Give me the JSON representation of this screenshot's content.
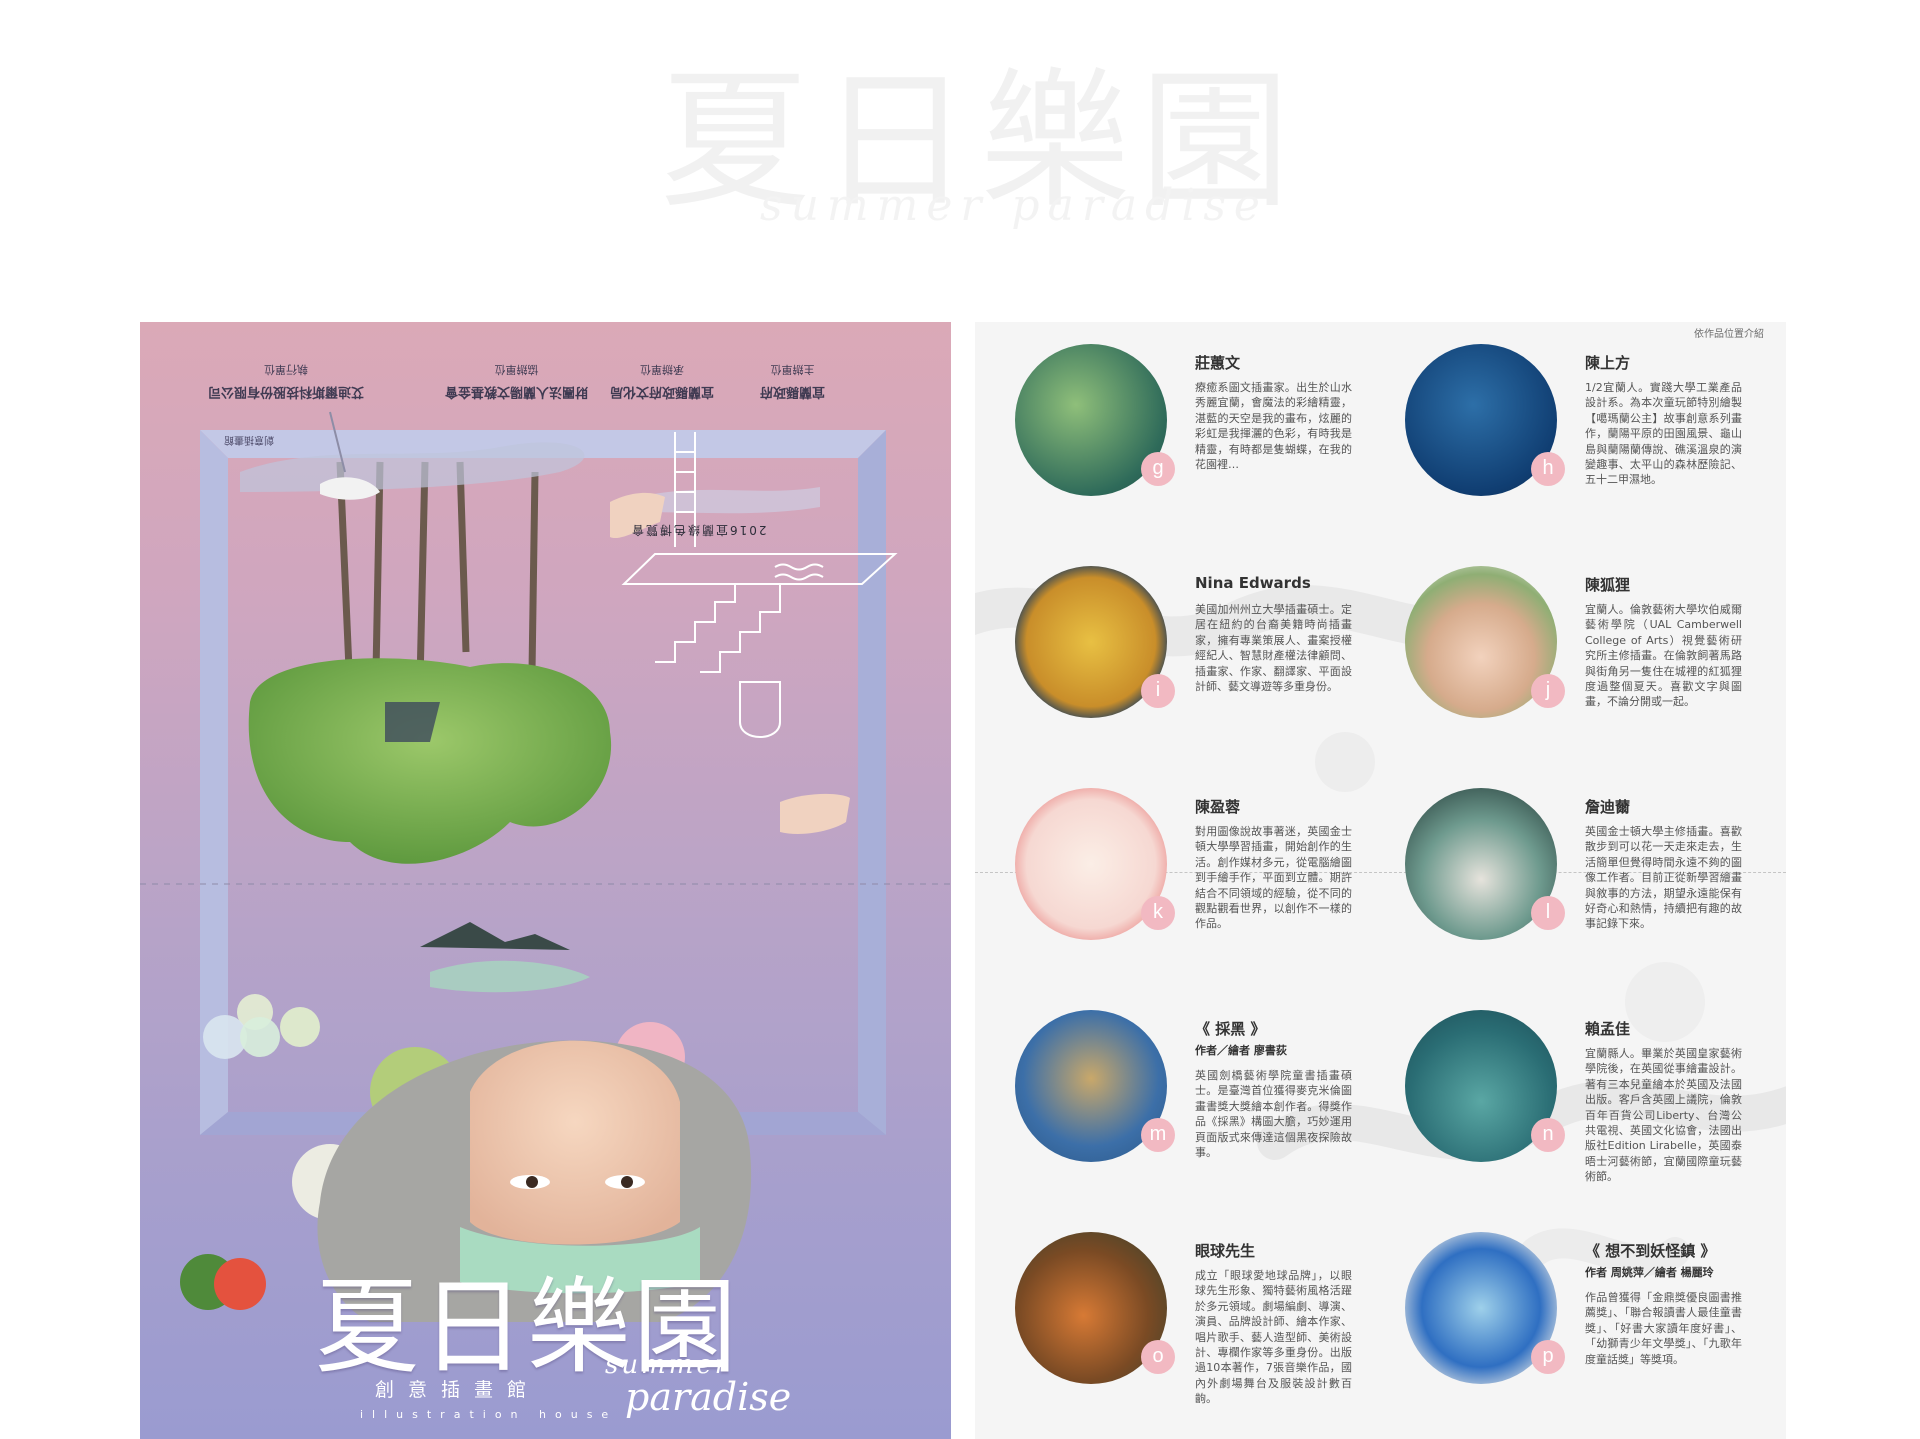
{
  "watermark": {
    "title": "夏日樂園",
    "subtitle": "summer paradise"
  },
  "poster": {
    "credits": [
      {
        "role": "主辦單位",
        "org": "宜蘭縣政府"
      },
      {
        "role": "承辦單位",
        "org": "宜蘭縣政府文化局"
      },
      {
        "role": "協辦單位",
        "org": "財團法人蘭陽文教基金會"
      },
      {
        "role": "執行單位",
        "org": "艾迪爾斯科技股份有限公司"
      }
    ],
    "year_title": "2016宜蘭綠色博覽會",
    "corner_text": "創意插畫館",
    "logo_cjk": "夏日樂園",
    "logo_subtitle": "創意插畫館",
    "logo_house": "illustration house",
    "logo_summer": "summer",
    "logo_paradise": "paradise"
  },
  "sheet": {
    "header": "依作品位置介紹",
    "artists": [
      {
        "letter": "g",
        "name": "莊蕙文",
        "bio": "療癒系圖文插畫家。出生於山水秀麗宜蘭，會魔法的彩繪精靈，湛藍的天空是我的畫布，炫麗的彩虹是我揮灑的色彩，有時我是精靈，有時都是隻蝴蝶，在我的花園裡…"
      },
      {
        "letter": "h",
        "name": "陳上方",
        "bio": "1/2宜蘭人。實踐大學工業產品設計系。為本次童玩節特別繪製【噶瑪蘭公主】故事創意系列畫作，蘭陽平原的田園風景、龜山島與蘭陽蘭傳說、礁溪溫泉的演變趣事、太平山的森林歷險記、五十二甲濕地。"
      },
      {
        "letter": "i",
        "name": "Nina Edwards",
        "bio": "美國加州州立大學插畫碩士。定居在紐約的台裔美籍時尚插畫家，擁有專業策展人、畫案授權經紀人、智慧財產權法律顧問、插畫家、作家、翻譯家、平面設計師、藝文導遊等多重身份。"
      },
      {
        "letter": "j",
        "name": "陳狐狸",
        "bio": "宜蘭人。倫敦藝術大學坎伯威爾藝術學院（UAL Camberwell College of Arts）視覺藝術研究所主修插畫。在倫敦飼著馬路與街角另一隻住在城裡的紅狐狸度過整個夏天。喜歡文字與圖畫，不論分開或一起。"
      },
      {
        "letter": "k",
        "name": "陳盈蓉",
        "bio": "對用圖像說故事著迷，英國金士頓大學學習插畫，開始創作的生活。創作媒材多元，從電腦繪圖到手繪手作，平面到立體。期許結合不同領域的經驗，從不同的觀點觀看世界，以創作不一樣的作品。"
      },
      {
        "letter": "l",
        "name": "詹迪薾",
        "bio": "英國金士頓大學主修插畫。喜歡散步到可以花一天走來走去，生活簡單但覺得時間永遠不夠的圖像工作者。目前正從新學習繪畫與敘事的方法，期望永遠能保有好奇心和熱情，持續把有趣的故事記錄下來。"
      },
      {
        "letter": "m",
        "name": "《 採黑 》",
        "credit": "作者／繪者 廖書荻",
        "bio": "英國劍橋藝術學院童書插畫碩士。是臺灣首位獲得麥克米倫圖畫書獎大獎繪本創作者。得獎作品《採黑》構圖大膽，巧妙運用頁面版式來傳達這個黑夜探險故事。"
      },
      {
        "letter": "n",
        "name": "賴孟佳",
        "bio": "宜蘭縣人。畢業於英國皇家藝術學院後，在英國從事繪畫設計。著有三本兒童繪本於英國及法國出版。客戶含英國上議院，倫敦百年百貨公司Liberty、台灣公共電視、英國文化協會，法國出版社Edition Lirabelle，英國泰晤士河藝術節，宜蘭國際童玩藝術節。"
      },
      {
        "letter": "o",
        "name": "眼球先生",
        "bio": "成立「眼球愛地球品牌」，以眼球先生形象、獨特藝術風格活躍於多元領域。劇場編劇、導演、演員、品牌設計師、繪本作家、唱片歌手、藝人造型師、美術設計、專欄作家等多重身份。出版過10本著作，7張音樂作品，國內外劇場舞台及服裝設計數百齣。"
      },
      {
        "letter": "p",
        "name": "《 想不到妖怪鎮 》",
        "credit": "作者 周姚萍／繪者 楊麗玲",
        "bio": "作品曾獲得「金鼎獎優良圖書推薦獎」、「聯合報讀書人最佳童書獎」、「好書大家讀年度好書」、「幼獅青少年文學獎」、「九歌年度童話獎」等獎項。"
      }
    ]
  }
}
